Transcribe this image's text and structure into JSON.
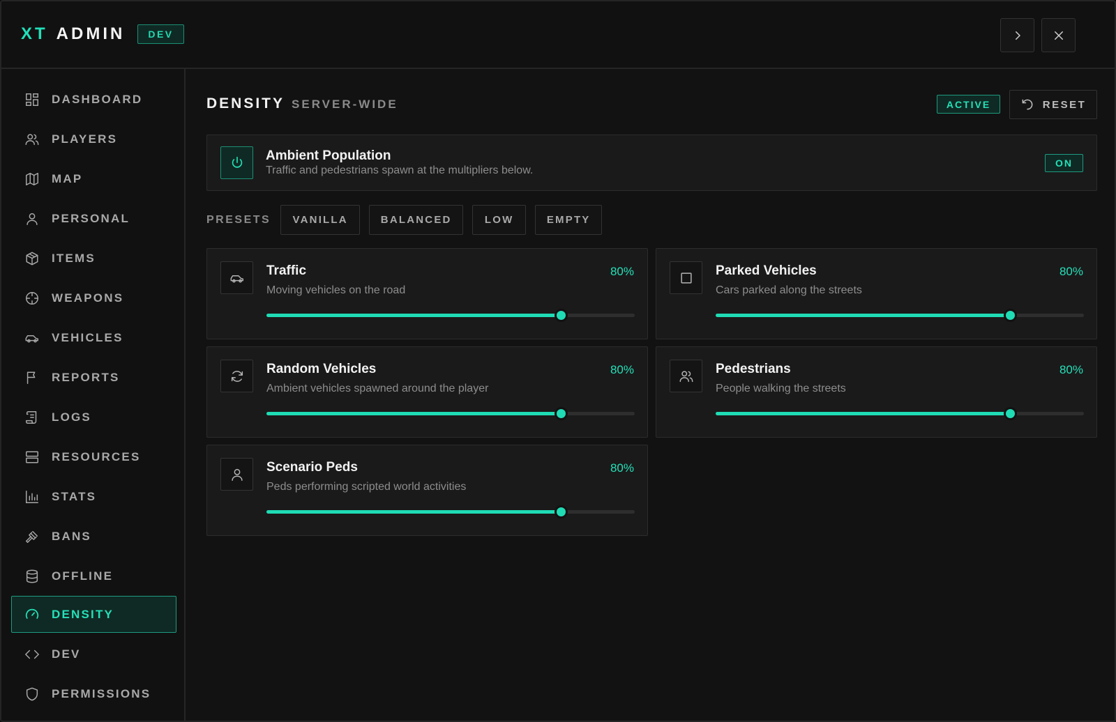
{
  "colors": {
    "accent": "#25e0b8",
    "background": "#121212",
    "panel": "#1a1a1a"
  },
  "header": {
    "brand_xt": "XT",
    "brand_admin": "ADMIN",
    "env_badge": "DEV",
    "buttons": [
      {
        "name": "forward-button",
        "icon": "chevron-right-icon"
      },
      {
        "name": "close-button",
        "icon": "close-icon"
      }
    ]
  },
  "sidebar": {
    "items": [
      {
        "label": "DASHBOARD",
        "icon": "dashboard-icon",
        "active": false
      },
      {
        "label": "PLAYERS",
        "icon": "users-icon",
        "active": false
      },
      {
        "label": "MAP",
        "icon": "map-icon",
        "active": false
      },
      {
        "label": "PERSONAL",
        "icon": "user-icon",
        "active": false
      },
      {
        "label": "ITEMS",
        "icon": "box-icon",
        "active": false
      },
      {
        "label": "WEAPONS",
        "icon": "crosshair-icon",
        "active": false
      },
      {
        "label": "VEHICLES",
        "icon": "car-icon",
        "active": false
      },
      {
        "label": "REPORTS",
        "icon": "flag-icon",
        "active": false
      },
      {
        "label": "LOGS",
        "icon": "scroll-icon",
        "active": false
      },
      {
        "label": "RESOURCES",
        "icon": "server-icon",
        "active": false
      },
      {
        "label": "STATS",
        "icon": "bar-chart-icon",
        "active": false
      },
      {
        "label": "BANS",
        "icon": "gavel-icon",
        "active": false
      },
      {
        "label": "OFFLINE",
        "icon": "database-icon",
        "active": false
      },
      {
        "label": "DENSITY",
        "icon": "gauge-icon",
        "active": true
      },
      {
        "label": "DEV",
        "icon": "code-icon",
        "active": false
      },
      {
        "label": "PERMISSIONS",
        "icon": "shield-icon",
        "active": false
      }
    ]
  },
  "main": {
    "title": "DENSITY",
    "subtitle": "SERVER-WIDE",
    "status_badge": "ACTIVE",
    "reset_label": "RESET",
    "ambient": {
      "title": "Ambient Population",
      "description": "Traffic and pedestrians spawn at the multipliers below.",
      "state": "ON",
      "icon": "power-icon"
    },
    "presets": {
      "label": "PRESETS",
      "options": [
        "VANILLA",
        "BALANCED",
        "LOW",
        "EMPTY"
      ]
    },
    "cards": [
      {
        "title": "Traffic",
        "description": "Moving vehicles on the road",
        "value_label": "80%",
        "value": 0.8,
        "icon": "car-icon"
      },
      {
        "title": "Parked Vehicles",
        "description": "Cars parked along the streets",
        "value_label": "80%",
        "value": 0.8,
        "icon": "square-icon"
      },
      {
        "title": "Random Vehicles",
        "description": "Ambient vehicles spawned around the player",
        "value_label": "80%",
        "value": 0.8,
        "icon": "refresh-icon"
      },
      {
        "title": "Pedestrians",
        "description": "People walking the streets",
        "value_label": "80%",
        "value": 0.8,
        "icon": "users-icon"
      },
      {
        "title": "Scenario Peds",
        "description": "Peds performing scripted world activities",
        "value_label": "80%",
        "value": 0.8,
        "icon": "user-icon"
      }
    ]
  }
}
